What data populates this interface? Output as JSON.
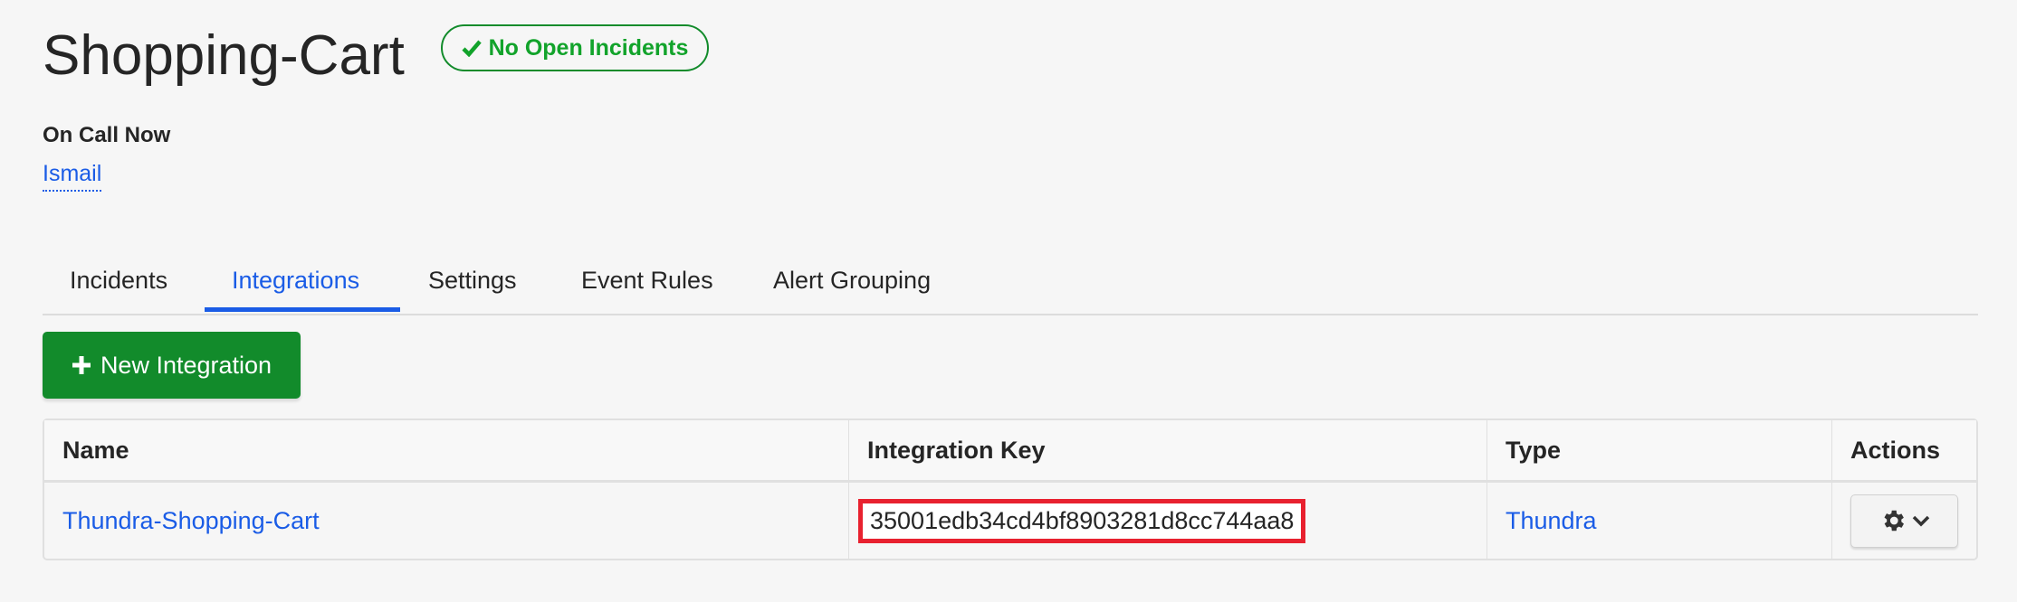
{
  "header": {
    "title": "Shopping-Cart",
    "status_badge": {
      "label": "No Open Incidents",
      "icon": "check-icon",
      "color": "#12a32b"
    }
  },
  "on_call": {
    "label": "On Call Now",
    "user": "Ismail"
  },
  "tabs": [
    {
      "label": "Incidents",
      "active": false
    },
    {
      "label": "Integrations",
      "active": true
    },
    {
      "label": "Settings",
      "active": false
    },
    {
      "label": "Event Rules",
      "active": false
    },
    {
      "label": "Alert Grouping",
      "active": false
    }
  ],
  "new_integration_button": {
    "label": "New Integration",
    "icon": "plus-icon",
    "color": "#128b2b"
  },
  "table": {
    "columns": [
      "Name",
      "Integration Key",
      "Type",
      "Actions"
    ],
    "rows": [
      {
        "name": "Thundra-Shopping-Cart",
        "key": "35001edb34cd4bf8903281d8cc744aa8",
        "type": "Thundra",
        "actions_icon": "gear-icon"
      }
    ]
  },
  "colors": {
    "accent": "#1a5ce6",
    "highlight": "#e8212f"
  }
}
